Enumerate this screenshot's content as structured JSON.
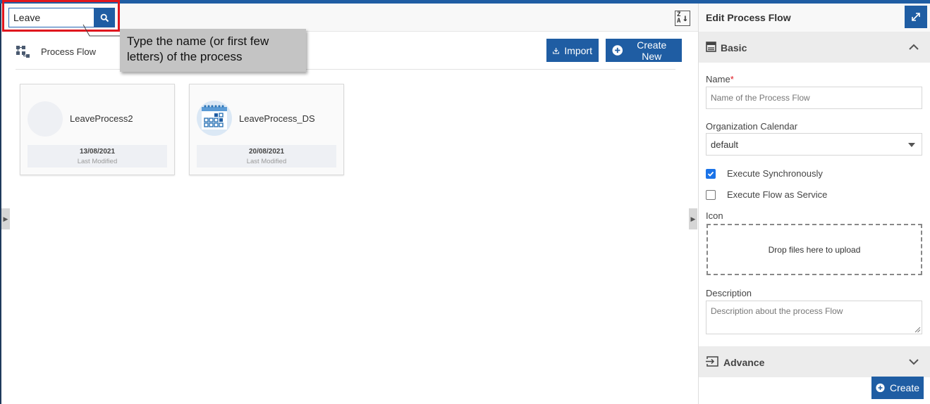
{
  "search": {
    "value": "Leave",
    "tooltip": "Type the name (or first few letters) of the process"
  },
  "toolbar": {
    "sort_icon": "sort-za-icon"
  },
  "header": {
    "title": "Process Flow",
    "import_label": "Import",
    "create_new_label": "Create New"
  },
  "cards": [
    {
      "name": "LeaveProcess2",
      "date": "13/08/2021",
      "modified_label": "Last Modified",
      "icon": "empty-avatar"
    },
    {
      "name": "LeaveProcess_DS",
      "date": "20/08/2021",
      "modified_label": "Last Modified",
      "icon": "calendar-icon"
    }
  ],
  "panel": {
    "title": "Edit Process Flow",
    "basic_label": "Basic",
    "name_label": "Name",
    "required_mark": "*",
    "name_placeholder": "Name of the Process Flow",
    "calendar_label": "Organization Calendar",
    "calendar_value": "default",
    "exec_sync_label": "Execute Synchronously",
    "exec_sync_checked": true,
    "exec_service_label": "Execute Flow as Service",
    "exec_service_checked": false,
    "icon_label": "Icon",
    "dropzone_text": "Drop files here to upload",
    "description_label": "Description",
    "description_placeholder": "Description about the process Flow",
    "advance_label": "Advance",
    "create_label": "Create"
  },
  "colors": {
    "primary": "#1f5da3",
    "highlight": "#e0161e",
    "tooltip_bg": "#c4c4c4"
  }
}
